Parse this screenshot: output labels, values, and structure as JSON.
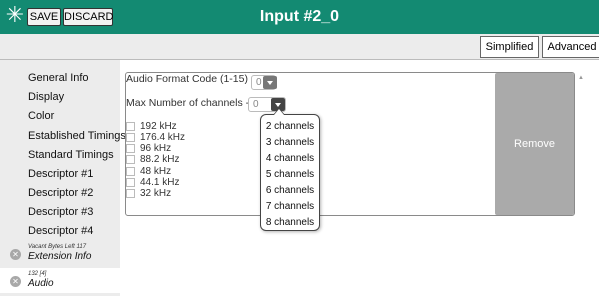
{
  "toolbar": {
    "app_icon": "asterisk-icon",
    "save_label": "SAVE",
    "discard_label": "DISCARD",
    "title": "Input #2_0"
  },
  "tabs": {
    "simplified": "Simplified",
    "advanced": "Advanced"
  },
  "sidebar": {
    "items": [
      {
        "label": "General Info"
      },
      {
        "label": "Display"
      },
      {
        "label": "Color"
      },
      {
        "label": "Established Timings"
      },
      {
        "label": "Standard Timings"
      },
      {
        "label": "Descriptor #1"
      },
      {
        "label": "Descriptor #2"
      },
      {
        "label": "Descriptor #3"
      },
      {
        "label": "Descriptor #4"
      }
    ],
    "blocks": [
      {
        "sub": "Vacant Bytes Left 117",
        "label": "Extension Info",
        "icon": "remove-x-icon"
      },
      {
        "sub": "132 [4]",
        "label": "Audio",
        "icon": "remove-x-icon",
        "active": true
      }
    ]
  },
  "panel": {
    "audio_format_label": "Audio Format Code (1-15)",
    "audio_format_value": "0",
    "max_channels_label": "Max Number of channels - 1",
    "max_channels_value": "0",
    "sample_rates": [
      "192 kHz",
      "176.4 kHz",
      "96 kHz",
      "88.2 kHz",
      "48 kHz",
      "44.1 kHz",
      "32 kHz"
    ],
    "remove_label": "Remove"
  },
  "channels_dropdown": {
    "options": [
      "2 channels",
      "3 channels",
      "4 channels",
      "5 channels",
      "6 channels",
      "7 channels",
      "8 channels"
    ]
  },
  "colors": {
    "titlebar": "#138a72",
    "remove_button": "#aaaaaa",
    "sidebar_bg": "#ececec"
  }
}
